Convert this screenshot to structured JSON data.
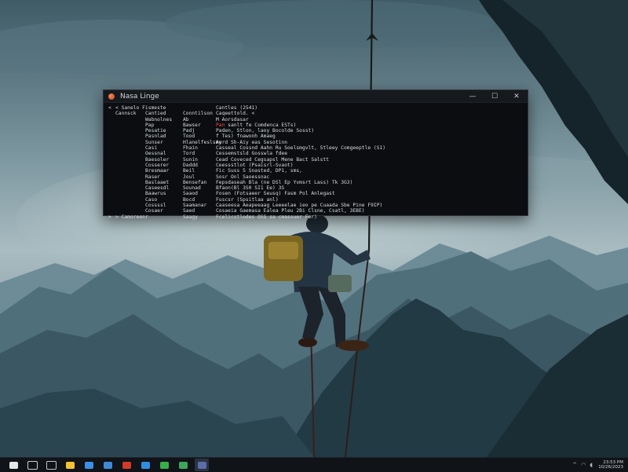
{
  "window": {
    "title": "Nasa Linge",
    "controls": {
      "minimize": "—",
      "maximize": "☐",
      "close": "✕"
    }
  },
  "console_lines": [
    {
      "c0": "<",
      "c1": "< Sanelo Fismeste",
      "c2": "",
      "c3": "",
      "c4": "Cantles (2541)"
    },
    {
      "c0": "",
      "c1": "Cannsck",
      "c2": "Cantied",
      "c3": "Conntilson",
      "c4": "Caqeettold. <"
    },
    {
      "c0": "",
      "c1": "",
      "c2": "Wabnolnes",
      "c3": "Ab",
      "c4": "M Aorsdasar"
    },
    {
      "c0": "",
      "c1": "",
      "c2": "Pap",
      "c3": "Bawser",
      "c4": "Pan sanlt fe Comdenca ESTs)",
      "red": "Pan"
    },
    {
      "c0": "",
      "c1": "",
      "c2": "Pesatie",
      "c3": "Padj",
      "c4": "Paden, Stlon, laoy Bocolde Sosst)"
    },
    {
      "c0": "",
      "c1": "",
      "c2": "Pasnlad",
      "c3": "Tood",
      "c4": "f Tes) fnawonh Amaeg"
    },
    {
      "c0": "",
      "c1": "",
      "c2": "Sunser",
      "c3": "Hlanelfeslsmy",
      "c4": "Aord Sh-Aiy eas Sesotinn"
    },
    {
      "c0": "",
      "c1": "",
      "c2": "Casi",
      "c3": "Fhain",
      "c4": "Casseal Cossnd Aahn Ru Soelsmgvlt, Stleey Comgeeptle (S1)"
    },
    {
      "c0": "",
      "c1": "",
      "c2": "Oessnal",
      "c3": "Tord",
      "c4": "Cessemstsld Gosswla fdee"
    },
    {
      "c0": "",
      "c1": "",
      "c2": "Baesoler",
      "c3": "Sunin",
      "c4": "Cead Coveced Cegsapsl Mene Bact Salstt"
    },
    {
      "c0": "",
      "c1": "",
      "c2": "Cosserer",
      "c3": "Daddd",
      "c4": "Ceessstlot (Psaisrl-Svaot)"
    },
    {
      "c0": "",
      "c1": "",
      "c2": "Bresmaar",
      "c3": "Beil",
      "c4": "Fic Suss 5 Snasted, DP1, sms,"
    },
    {
      "c0": "",
      "c1": "",
      "c2": "Raser",
      "c3": "Joul",
      "c4": "Sosr Onl Saoessnac"
    },
    {
      "c0": "",
      "c1": "",
      "c2": "Baslaaet",
      "c3": "Bensefan",
      "c4": "Fepsdaseah Bla (ne DSl Ep Yvmsrt Lass) Tk 3G3)"
    },
    {
      "c0": "",
      "c1": "",
      "c2": "Caseesdl",
      "c3": "Sounad",
      "c4": "Bfaon(Bl 3S0 SI1 Ee) 3S"
    },
    {
      "c0": "",
      "c1": "",
      "c2": "Baawrus",
      "c3": "Saaod",
      "c4": "Fosen (Fotsaeer Seusq) Fasm Pol Anlegast"
    },
    {
      "c0": "",
      "c1": "",
      "c2": "Caso",
      "c3": "Bocd",
      "c4": "Fuscsr (Spsitlaa anl)"
    },
    {
      "c0": "",
      "c1": "",
      "c2": "Cossssl",
      "c3": "Saamanar",
      "c4": "Caaseesa Aeapeeaag Leeeelae ieo pe Cuaada Sbe Pine F9IP)"
    },
    {
      "c0": "",
      "c1": "",
      "c2": "Cosaer",
      "c3": "Saed",
      "c4": "Cosaeia Gaemasa Ealea Pleu 2Bi Clsne, Csatl, 3EBE)"
    },
    {
      "c0": ">",
      "c1": "> Camoreenr",
      "c2": "",
      "c3": "Saagy",
      "c4": "Fcelicstlodes OSS sa cmassuer Fer)"
    }
  ],
  "taskbar": {
    "items": [
      "start",
      "search",
      "task-view",
      "file-explorer",
      "browser",
      "mail",
      "edge",
      "chat",
      "photos",
      "store",
      "terminal"
    ],
    "colors": [
      "#e6e6e6",
      "#cfcfcf",
      "#bfc6ce",
      "#f2c230",
      "#3c8ee6",
      "#3f8ad8",
      "#d23a2a",
      "#2e8fe0",
      "#36b04a",
      "#3fa65b",
      "#5a6ea8"
    ],
    "clock_time": "23:53 PM",
    "clock_date": "10/26/2023"
  }
}
